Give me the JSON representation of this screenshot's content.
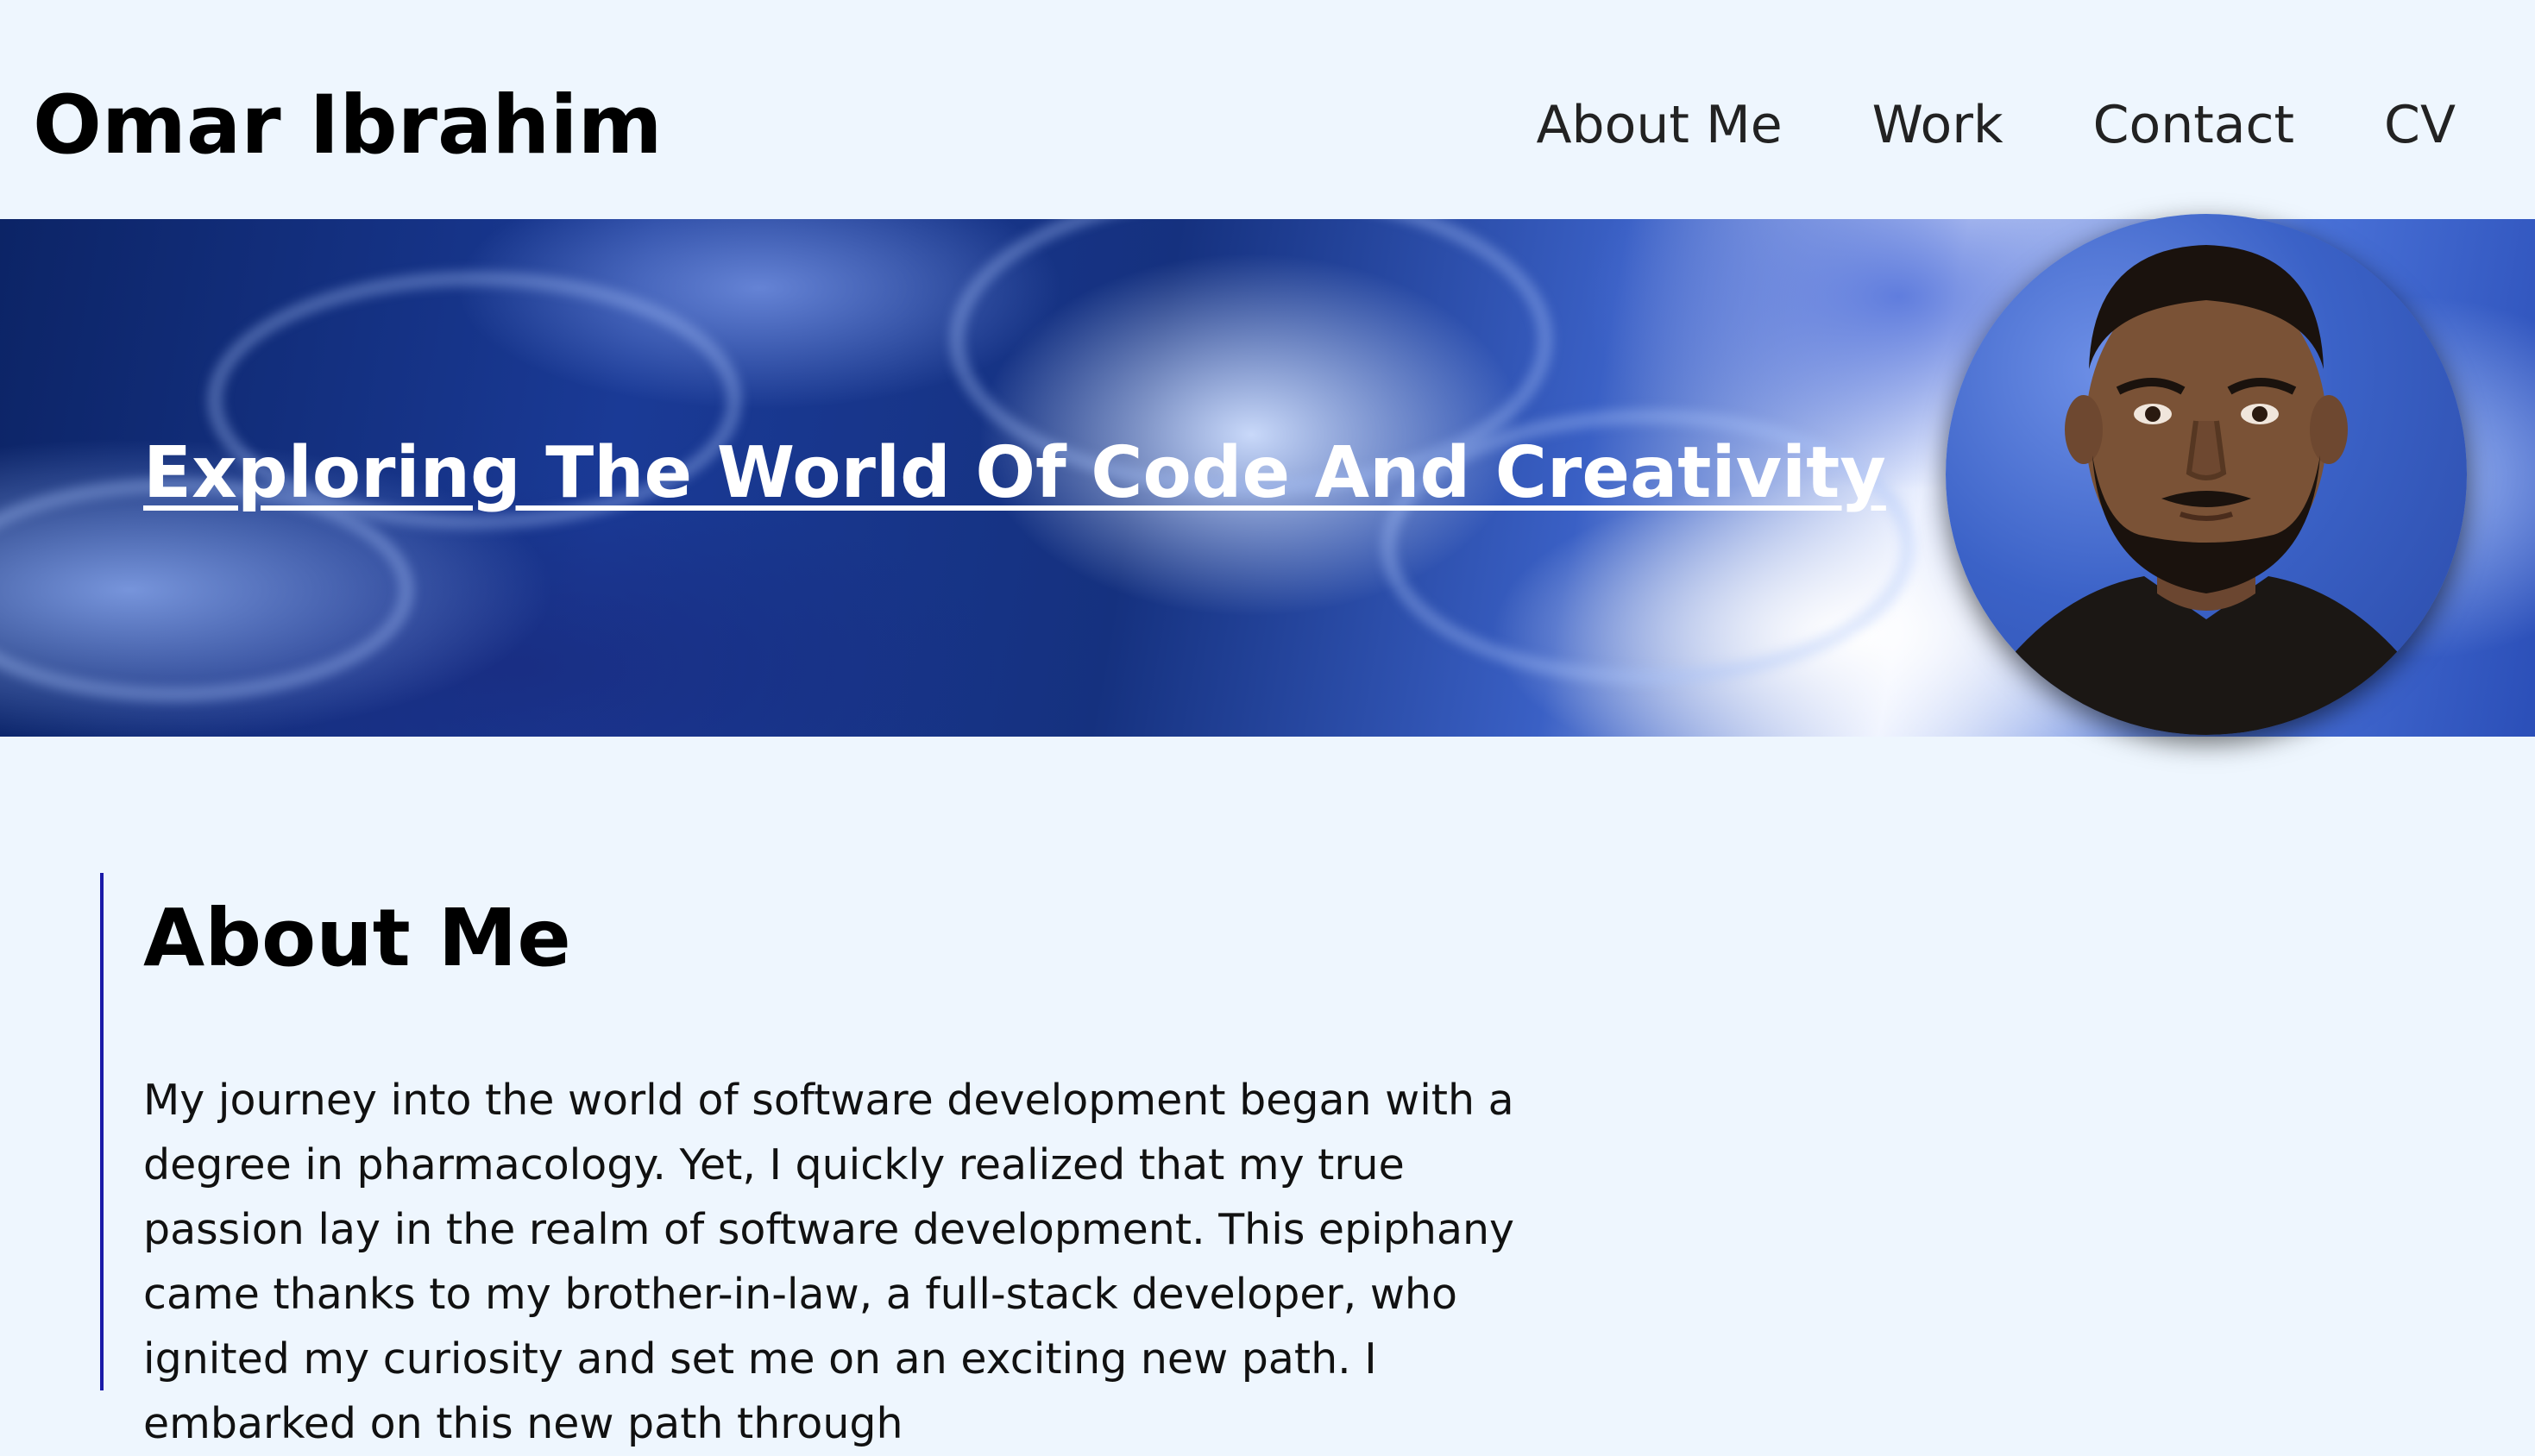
{
  "header": {
    "site_title": "Omar Ibrahim",
    "nav": {
      "about": "About Me",
      "work": "Work",
      "contact": "Contact",
      "cv": "CV"
    }
  },
  "hero": {
    "title": "Exploring The World Of Code And Creativity",
    "avatar_icon": "profile-photo"
  },
  "about": {
    "heading": "About Me",
    "paragraph": "My journey into the world of software development began with a degree in pharmacology. Yet, I quickly realized that my true passion lay in the realm of software development. This epiphany came thanks to my brother-in-law, a full-stack developer, who ignited my curiosity and set me on an exciting new path. I embarked on this new path through"
  },
  "colors": {
    "page_background": "#eef6fe",
    "accent_border": "#1a1aa8",
    "hero_blue": "#1a3a96"
  }
}
